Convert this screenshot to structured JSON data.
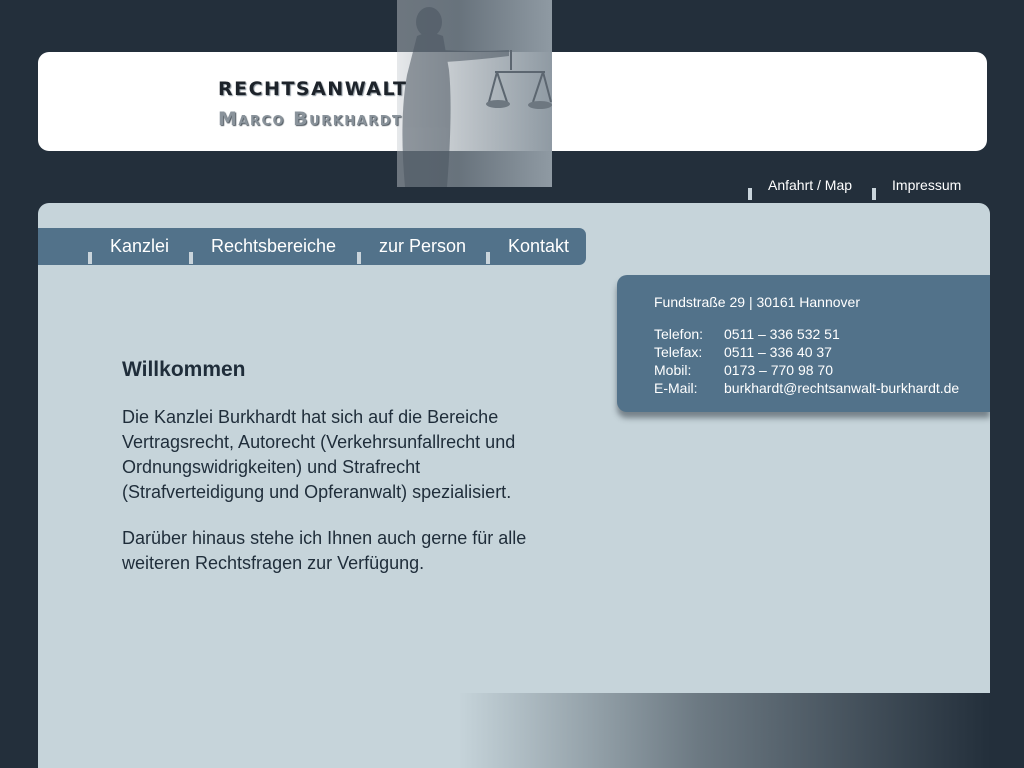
{
  "header": {
    "brand_line1": "RECHTSANWALT",
    "brand_line2": "Marco Burkhardt"
  },
  "top_links": [
    {
      "label": "Anfahrt / Map"
    },
    {
      "label": "Impressum"
    }
  ],
  "nav": [
    {
      "label": "Kanzlei"
    },
    {
      "label": "Rechtsbereiche"
    },
    {
      "label": "zur Person"
    },
    {
      "label": "Kontakt"
    }
  ],
  "contact": {
    "address": "Fundstraße 29 | 30161 Hannover",
    "rows": [
      {
        "label": "Telefon:",
        "value": "0511 – 336 532 51"
      },
      {
        "label": "Telefax:",
        "value": "0511 – 336 40 37"
      },
      {
        "label": "Mobil:",
        "value": "0173 – 770 98 70"
      },
      {
        "label": "E-Mail:",
        "value": "burkhardt@rechtsanwalt-burkhardt.de"
      }
    ]
  },
  "main": {
    "title": "Willkommen",
    "paragraphs": [
      "Die Kanzlei Burkhardt hat sich auf die Bereiche Vertragsrecht, Autorecht (Verkehrsunfallrecht und Ordnungswidrigkeiten) und Strafrecht (Strafverteidigung und Opferanwalt) spezialisiert.",
      "Darüber hinaus stehe ich Ihnen auch gerne für alle weiteren Rechtsfragen zur Verfügung."
    ]
  },
  "colors": {
    "background": "#232f3b",
    "panel": "#c6d4da",
    "accent": "#52728a",
    "text": "#1f2d3a"
  },
  "icons": {
    "header_image": "justitia-statue-icon"
  }
}
